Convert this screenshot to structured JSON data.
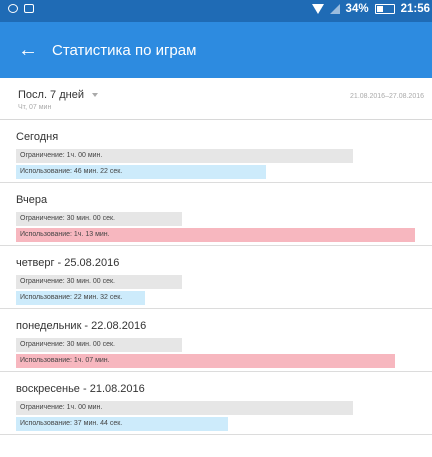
{
  "status_bar": {
    "battery": "34%",
    "time": "21:56",
    "icons": [
      "notification-icon",
      "image-icon",
      "wifi-icon",
      "signal-icon",
      "battery-icon"
    ]
  },
  "app_bar": {
    "back_icon": "←",
    "title": "Статистика по играм",
    "color": "#2d8be0"
  },
  "filter": {
    "period": "Посл. 7 дней",
    "sub": "Чт, 07 мин",
    "range": "21.08.2016–27.08.2016"
  },
  "colors": {
    "within_limit": "#cdebfb",
    "over_limit": "#f7b7bf",
    "limit": "#e6e6e6"
  },
  "days": [
    {
      "name": "Сегодня",
      "limit": "Ограничение: 1ч. 00 мин.",
      "usage": "Использование: 46 мин. 22 сек.",
      "limit_fraction": 0.81,
      "usage_fraction": 0.6,
      "over": false
    },
    {
      "name": "Вчера",
      "limit": "Ограничение: 30 мин. 00 сек.",
      "usage": "Использование: 1ч. 13 мин.",
      "limit_fraction": 0.4,
      "usage_fraction": 0.96,
      "over": true
    },
    {
      "name": "четверг - 25.08.2016",
      "limit": "Ограничение: 30 мин. 00 сек.",
      "usage": "Использование: 22 мин. 32 сек.",
      "limit_fraction": 0.4,
      "usage_fraction": 0.31,
      "over": false
    },
    {
      "name": "понедельник - 22.08.2016",
      "limit": "Ограничение: 30 мин. 00 сек.",
      "usage": "Использование: 1ч. 07 мин.",
      "limit_fraction": 0.4,
      "usage_fraction": 0.91,
      "over": true
    },
    {
      "name": "воскресенье - 21.08.2016",
      "limit": "Ограничение: 1ч. 00 мин.",
      "usage": "Использование: 37 мин. 44 сек.",
      "limit_fraction": 0.81,
      "usage_fraction": 0.51,
      "over": false
    }
  ]
}
